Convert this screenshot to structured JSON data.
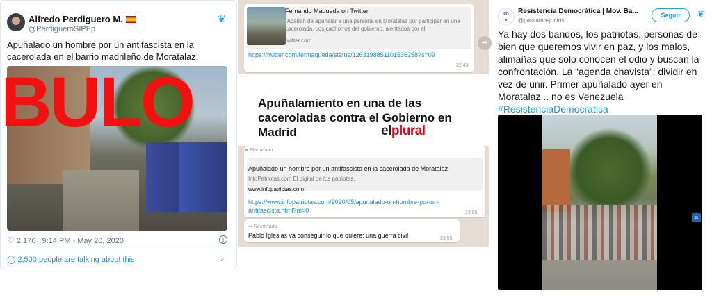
{
  "tweet_left": {
    "name": "Alfredo Perdiguero M.",
    "handle": "@PerdigueroSIPEp",
    "text": "Apuñalado un hombre por un antifascista en la cacerolada en el barrio madrileño de Moratalaz.",
    "overlay": "BULO",
    "likes": "2,176",
    "timestamp": "9:14 PM - May 20, 2020",
    "talking": "2,500 people are talking about this",
    "icons": [
      "twitter-bird-icon",
      "heart-icon",
      "info-icon",
      "comment-icon",
      "chevron-right-icon"
    ]
  },
  "whatsapp": {
    "msg1": {
      "preview_title": "Fernando Maqueda on Twitter",
      "preview_desc": "“Acaban de apuñalar a una persona en Moratalaz por participar en una cacerolada. Los cachorros del gobierno, alentados por el",
      "preview_domain": "twitter.com",
      "link": "https://twitter.com/fermaqueda/status/1263198851101536258?s=09",
      "time": "22:43"
    },
    "headline": "Apuñalamiento en una de las caceroladas contra el Gobierno en Madrid",
    "logo_left": "el",
    "logo_right": "plural",
    "msg2": {
      "forwarded": "Reenviado",
      "preview_title": "Apuñalado un hombre por un antifascista en la cacerolada de Moratalaz",
      "preview_desc": "InfoPatriotas.com El digital de los patriotas.",
      "preview_domain": "www.infopatriotas.com",
      "link": "https://www.infopatriotas.com/2020/05/apunalado-un-hombre-por-un-antifascista.html?m=0",
      "time": "23:55"
    },
    "msg3": {
      "forwarded": "Reenviado",
      "text": "Pablo Iglesias va conseguir lo que quiere: una guerra civil",
      "time": "23:55"
    }
  },
  "tweet_right": {
    "name": "Resistencia Democrática | Mov. Ba...",
    "handle": "@paseamosjuntos",
    "follow_label": "Seguir",
    "text": "Ya hay dos bandos, los patriotas, personas de bien que queremos vivir en paz, y los malos, alimañas que solo conocen el odio y buscan la confrontación. La “agenda chavista”: dividir en vez de unir. Primer apuñalado ayer en Moratalaz... no es Venezuela",
    "hashtag": "#ResistenciaDemocratica",
    "colors": {
      "link": "#1b95e0",
      "accent": "#1da1f2"
    }
  },
  "colors": {
    "bulo_red": "#f21010",
    "whatsapp_bg": "#e5ddd5",
    "plural_red": "#e30613"
  }
}
